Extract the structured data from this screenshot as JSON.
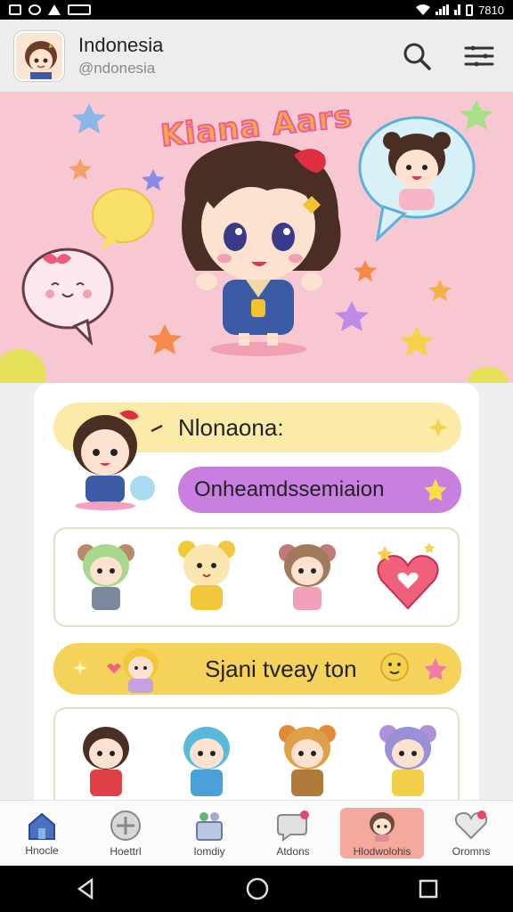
{
  "status_bar": {
    "time": "7810"
  },
  "header": {
    "title": "Indonesia",
    "handle": "@ndonesia"
  },
  "hero": {
    "title": "Kiana Aars"
  },
  "card": {
    "pill1": "Nlonaona:",
    "pill2": "Onheamdssemiaion",
    "pill3": "Sjani tveay ton"
  },
  "bottom_nav": [
    {
      "label": "Hnocle",
      "icon": "home-icon"
    },
    {
      "label": "Hoettrl",
      "icon": "sticker-icon"
    },
    {
      "label": "Iomdiy",
      "icon": "basket-icon"
    },
    {
      "label": "Atdons",
      "icon": "heart-bubble-icon"
    },
    {
      "label": "Hlodwolohis",
      "icon": "character-icon"
    },
    {
      "label": "Oromns",
      "icon": "heart-icon"
    }
  ],
  "colors": {
    "hero_bg": "#f8c8d2",
    "active_tab": "#f5a89c",
    "pill_yellow": "#fbeaa8",
    "pill_purple": "#c87fe0",
    "pill_gold": "#f5d25a"
  }
}
